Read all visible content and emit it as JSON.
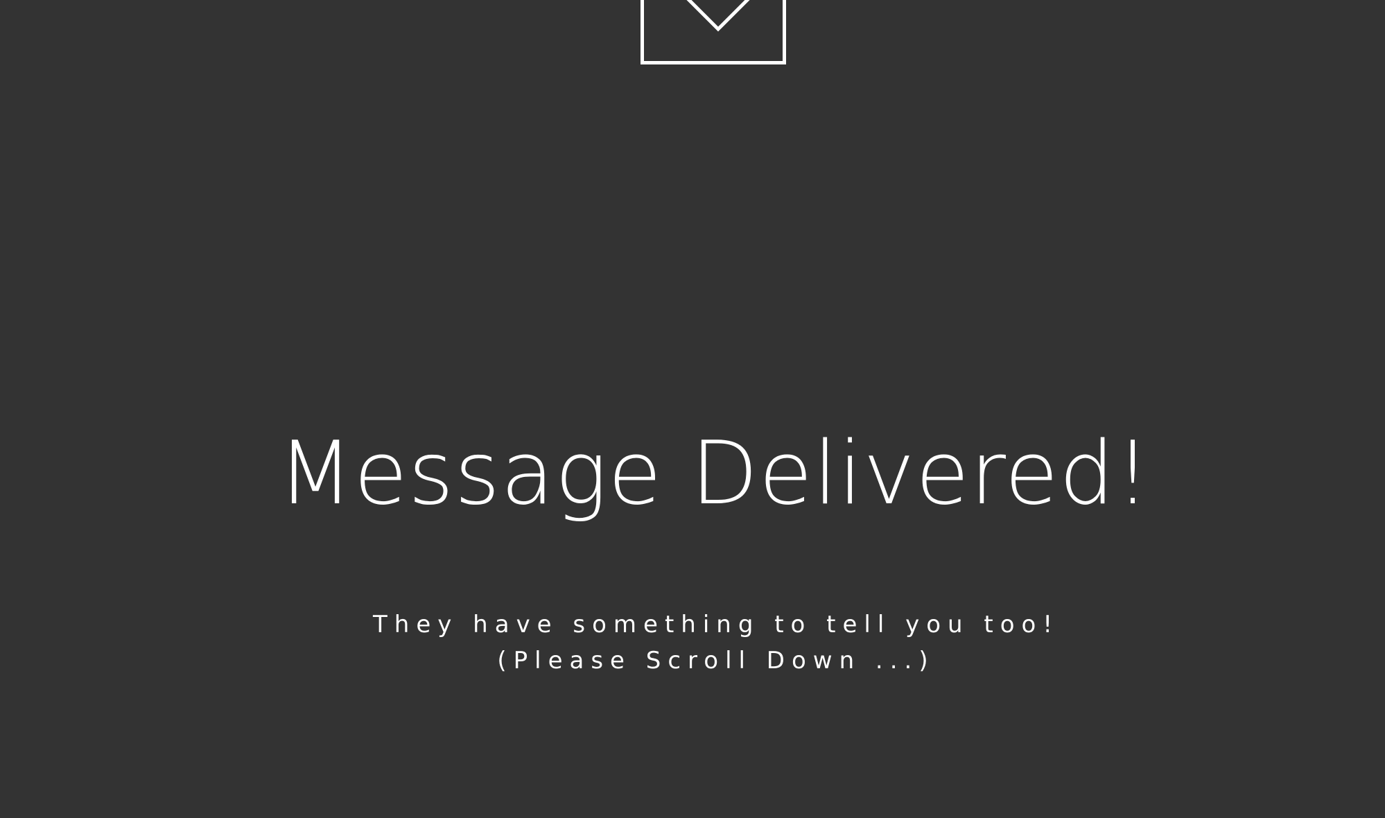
{
  "page": {
    "background_color": "#333333",
    "text_color": "#ffffff"
  },
  "hero": {
    "icon": "envelope-icon",
    "title": "Message Delivered!",
    "subtitle_line1": "They have something to tell you too!",
    "subtitle_line2": "(Please Scroll Down ...)"
  }
}
